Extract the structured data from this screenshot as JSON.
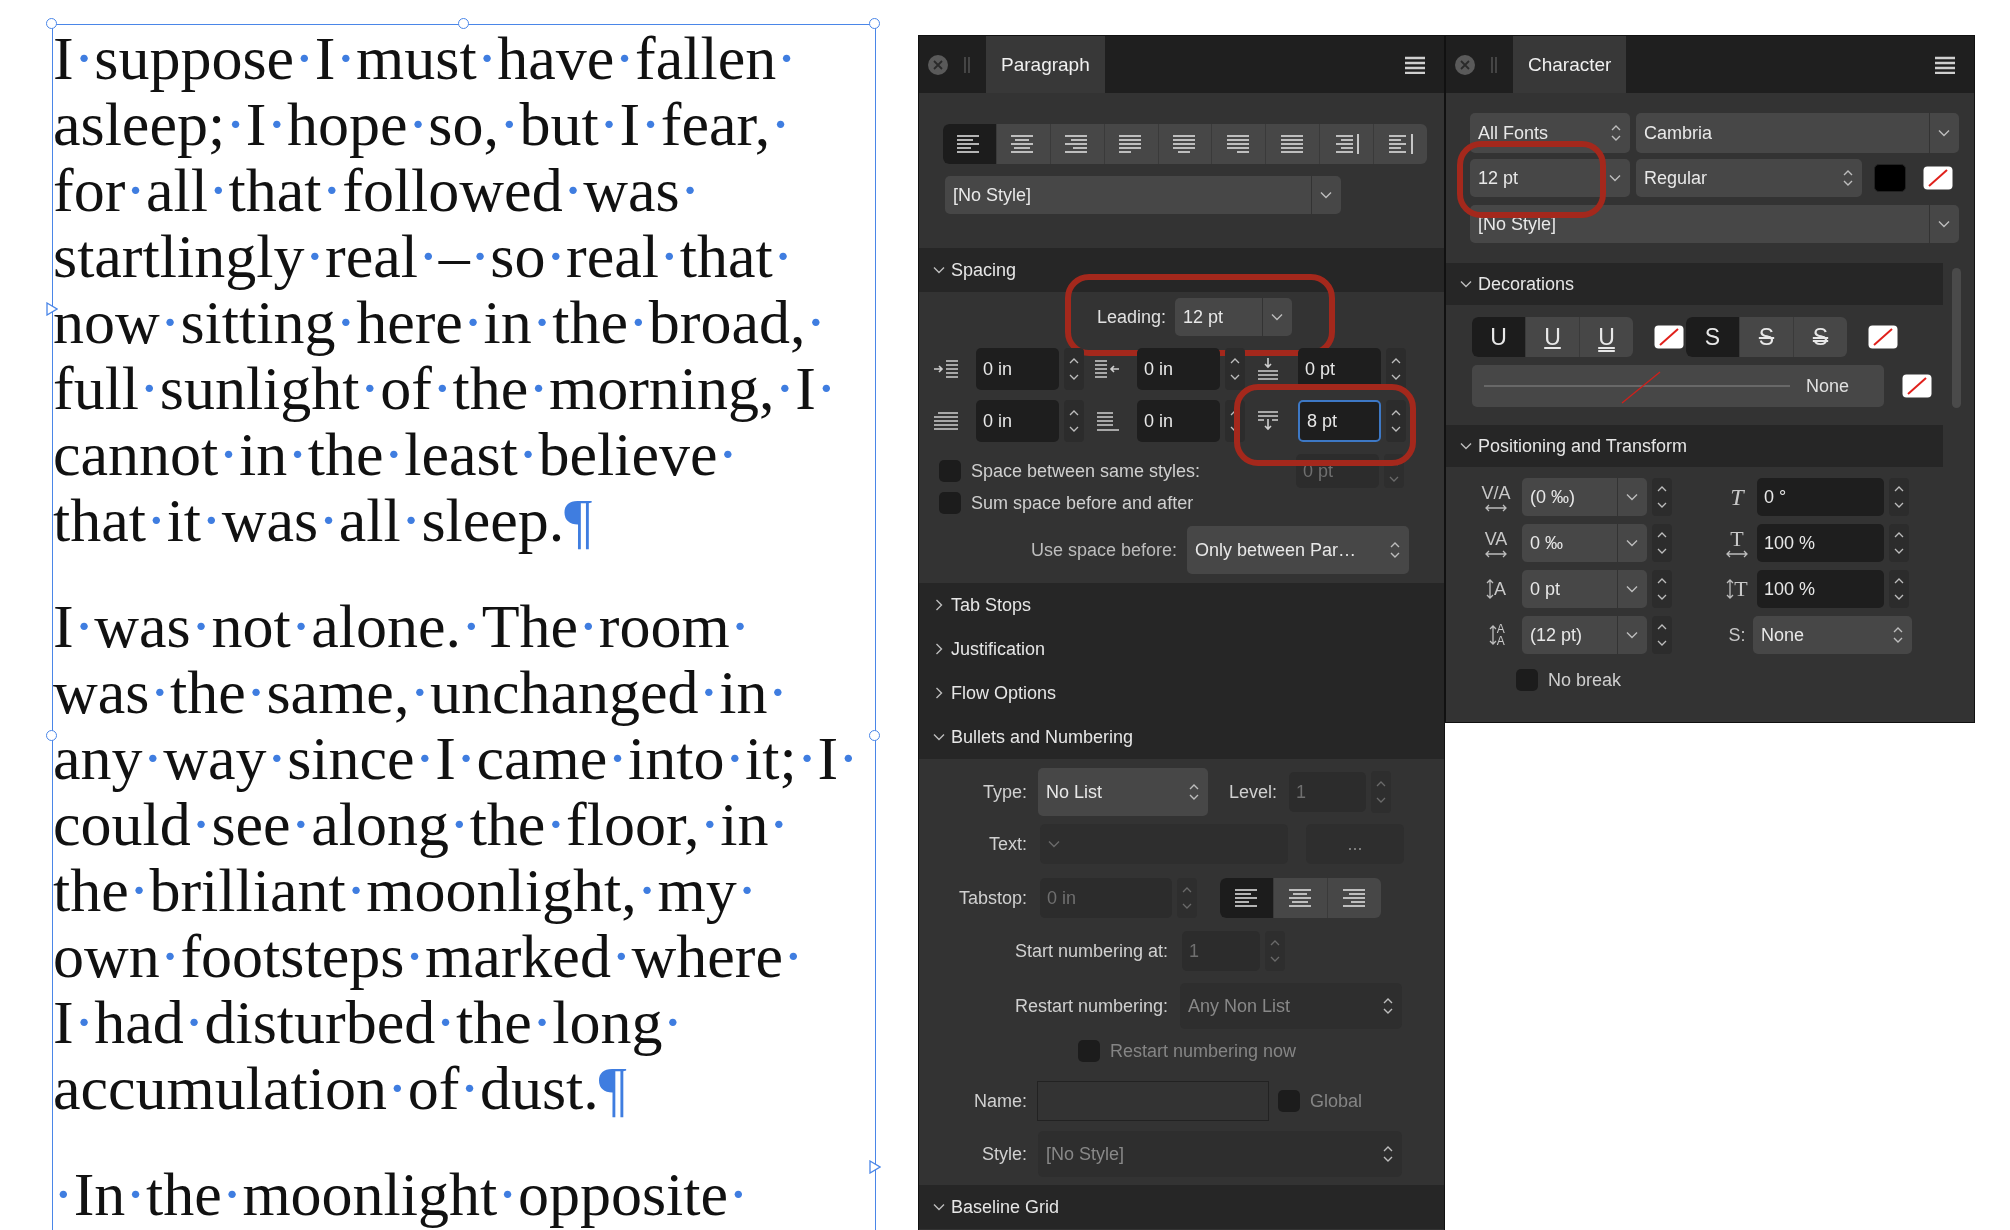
{
  "text_frame": {
    "paragraphs": [
      {
        "lines": [
          "I·suppose·I·must·have·fallen·",
          "asleep;·I·hope·so,·but·I·fear,·",
          "for·all·that·followed·was·",
          "startlingly·real·–·so·real·that·",
          "now·sitting·here·in·the·broad,·",
          "full·sunlight·of·the·morning,·I·",
          "cannot·in·the·least·believe·",
          "that·it·was·all·sleep.¶"
        ]
      },
      {
        "lines": [
          "I·was·not·alone.·The·room·",
          "was·the·same,·unchanged·in·",
          "any·way·since·I·came·into·it;·I·",
          "could·see·along·the·floor,·in·",
          "the·brilliant·moonlight,·my·",
          "own·footsteps·marked·where·",
          "I·had·disturbed·the·long·",
          "accumulation·of·dust.¶"
        ]
      },
      {
        "lines": [
          "·In·the·moonlight·opposite·"
        ]
      }
    ]
  },
  "paragraph_panel": {
    "title": "Paragraph",
    "alignment": [
      {
        "kind": "left",
        "selected": true
      },
      {
        "kind": "center",
        "selected": false
      },
      {
        "kind": "right",
        "selected": false
      },
      {
        "kind": "justify-left",
        "selected": false
      },
      {
        "kind": "justify-center",
        "selected": false
      },
      {
        "kind": "justify-right",
        "selected": false
      },
      {
        "kind": "justify-all",
        "selected": false
      },
      {
        "kind": "towards-spine",
        "selected": false
      },
      {
        "kind": "away-from-spine",
        "selected": false
      }
    ],
    "style": "[No Style]",
    "sections": [
      {
        "kind": "spacing",
        "title": "Spacing",
        "expanded": true,
        "leading": {
          "label": "Leading:",
          "value": "12 pt"
        },
        "fields": [
          {
            "kind": "left-indent",
            "value": "0 in",
            "focused": false
          },
          {
            "kind": "right-indent",
            "value": "0 in",
            "focused": false
          },
          {
            "kind": "space-before",
            "value": "0 pt",
            "focused": false
          },
          {
            "kind": "first-line-indent",
            "value": "0 in",
            "focused": false
          },
          {
            "kind": "last-line-indent",
            "value": "0 in",
            "focused": false
          },
          {
            "kind": "space-after",
            "value": "8 pt",
            "focused": true
          }
        ],
        "same_styles": {
          "label": "Space between same styles:",
          "checked": false,
          "value": "0 pt"
        },
        "sum_space": {
          "label": "Sum space before and after",
          "checked": false
        },
        "use_space_before": {
          "label": "Use space before:",
          "value": "Only between Par…"
        }
      },
      {
        "kind": "plain",
        "title": "Tab Stops",
        "expanded": false
      },
      {
        "kind": "plain",
        "title": "Justification",
        "expanded": false
      },
      {
        "kind": "plain",
        "title": "Flow Options",
        "expanded": false
      },
      {
        "kind": "bullets",
        "title": "Bullets and Numbering",
        "expanded": true,
        "type": {
          "label": "Type:",
          "value": "No List",
          "disabled": false
        },
        "level": {
          "label": "Level:",
          "value": "1",
          "disabled": true
        },
        "text": {
          "label": "Text:",
          "button": "...",
          "disabled": true
        },
        "tabstop": {
          "label": "Tabstop:",
          "value": "0 in",
          "disabled": true,
          "alignment": [
            {
              "kind": "left",
              "selected": true
            },
            {
              "kind": "center",
              "selected": false
            },
            {
              "kind": "right",
              "selected": false
            }
          ]
        },
        "start_numbering": {
          "label": "Start numbering at:",
          "value": "1",
          "disabled": true
        },
        "restart_numbering": {
          "label": "Restart numbering:",
          "value": "Any Non List",
          "disabled": true
        },
        "restart_now": {
          "label": "Restart numbering now",
          "checked": false,
          "disabled": true
        },
        "name": {
          "label": "Name:",
          "disabled": true
        },
        "global": {
          "label": "Global",
          "checked": false,
          "disabled": true
        },
        "style": {
          "label": "Style:",
          "value": "[No Style]",
          "disabled": true
        }
      },
      {
        "kind": "plain",
        "title": "Baseline Grid",
        "expanded": true
      }
    ]
  },
  "character_panel": {
    "title": "Character",
    "font_collection": "All Fonts",
    "font_family": "Cambria",
    "font_size": "12 pt",
    "font_style": "Regular",
    "swatches": [
      {
        "kind": "fill",
        "color": "#000000"
      },
      {
        "kind": "none"
      }
    ],
    "style": "[No Style]",
    "decorations": {
      "title": "Decorations",
      "expanded": true,
      "underline": [
        {
          "kind": "none",
          "label": "U",
          "selected": true
        },
        {
          "kind": "single",
          "label": "U",
          "selected": false
        },
        {
          "kind": "double",
          "label": "U",
          "selected": false
        }
      ],
      "strikethrough": [
        {
          "kind": "none",
          "label": "S",
          "selected": true
        },
        {
          "kind": "single",
          "label": "S",
          "selected": false
        },
        {
          "kind": "double",
          "label": "S",
          "selected": false
        }
      ],
      "line_style": "None"
    },
    "positioning": {
      "title": "Positioning and Transform",
      "expanded": true,
      "left": [
        {
          "kind": "kerning",
          "icon": "V/A",
          "value": "(0 ‰)"
        },
        {
          "kind": "tracking",
          "icon": "VA",
          "value": "0 ‰"
        },
        {
          "kind": "baseline-shift",
          "icon": "A",
          "value": "0 pt"
        },
        {
          "kind": "leading",
          "icon": "AA",
          "value": "(12 pt)"
        }
      ],
      "right": [
        {
          "kind": "skew",
          "icon": "T",
          "value": "0 °"
        },
        {
          "kind": "horizontal-scale",
          "icon": "T",
          "value": "100 %"
        },
        {
          "kind": "vertical-scale",
          "icon": "T",
          "value": "100 %"
        },
        {
          "kind": "typography",
          "icon": "S:",
          "value": "None"
        }
      ],
      "no_break": {
        "label": "No break",
        "checked": false
      }
    }
  }
}
